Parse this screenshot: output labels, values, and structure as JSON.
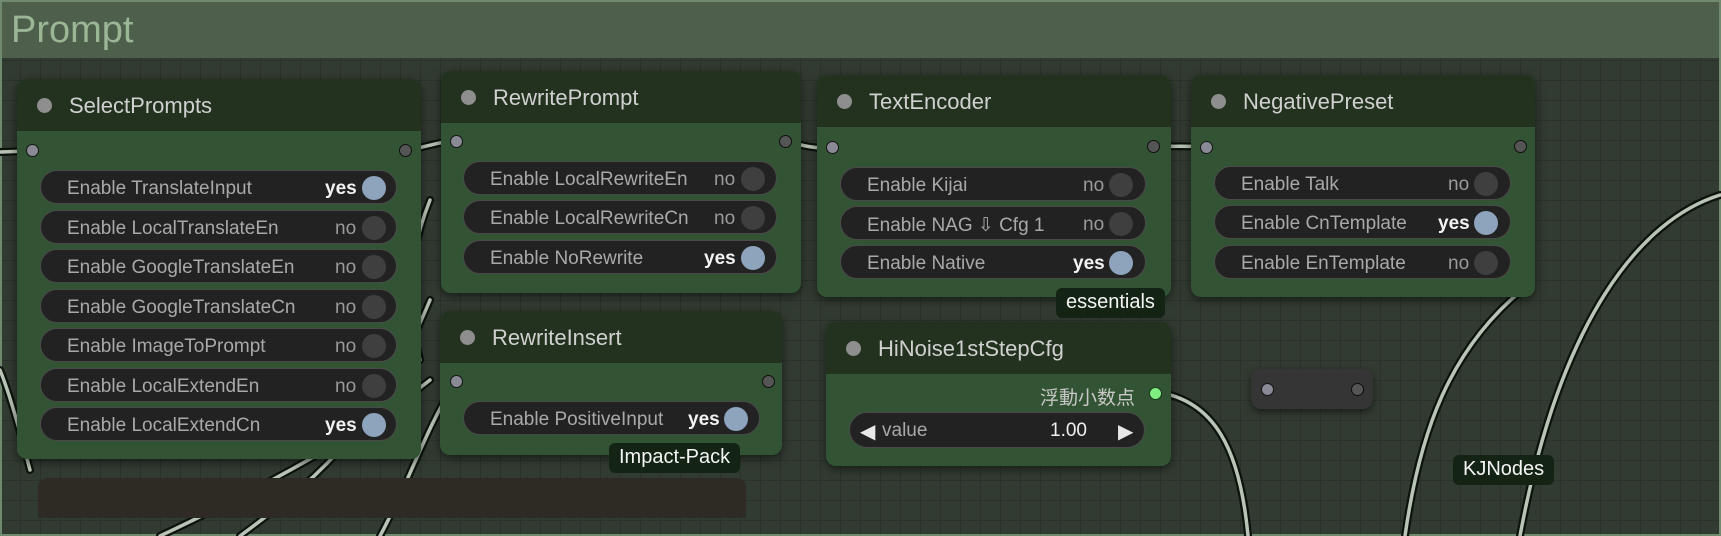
{
  "group": {
    "title": "Prompt"
  },
  "nodes": {
    "select_prompts": {
      "title": "SelectPrompts",
      "toggles": [
        {
          "label": "Enable TranslateInput",
          "value": "yes"
        },
        {
          "label": "Enable LocalTranslateEn",
          "value": "no"
        },
        {
          "label": "Enable GoogleTranslateEn",
          "value": "no"
        },
        {
          "label": "Enable GoogleTranslateCn",
          "value": "no"
        },
        {
          "label": "Enable ImageToPrompt",
          "value": "no"
        },
        {
          "label": "Enable LocalExtendEn",
          "value": "no"
        },
        {
          "label": "Enable LocalExtendCn",
          "value": "yes"
        }
      ]
    },
    "rewrite_prompt": {
      "title": "RewritePrompt",
      "toggles": [
        {
          "label": "Enable LocalRewriteEn",
          "value": "no"
        },
        {
          "label": "Enable LocalRewriteCn",
          "value": "no"
        },
        {
          "label": "Enable NoRewrite",
          "value": "yes"
        }
      ]
    },
    "rewrite_insert": {
      "title": "RewriteInsert",
      "toggles": [
        {
          "label": "Enable PositiveInput",
          "value": "yes"
        }
      ],
      "badge": "Impact-Pack"
    },
    "text_encoder": {
      "title": "TextEncoder",
      "toggles": [
        {
          "label": "Enable Kijai",
          "value": "no"
        },
        {
          "label": "Enable NAG ⇩ Cfg 1",
          "value": "no"
        },
        {
          "label": "Enable Native",
          "value": "yes"
        }
      ],
      "badge": "essentials"
    },
    "negative_preset": {
      "title": "NegativePreset",
      "toggles": [
        {
          "label": "Enable Talk",
          "value": "no"
        },
        {
          "label": "Enable CnTemplate",
          "value": "yes"
        },
        {
          "label": "Enable EnTemplate",
          "value": "no"
        }
      ]
    },
    "hinoise": {
      "title": "HiNoise1stStepCfg",
      "output_label": "浮動小数点",
      "widget_label": "value",
      "widget_value": "1.00",
      "badge": "KJNodes"
    }
  },
  "colors": {
    "node_body": "#335434",
    "node_header": "#22321f",
    "toggle_on_knob": "#8ea3bc",
    "float_output_slot": "#7ff07f"
  }
}
